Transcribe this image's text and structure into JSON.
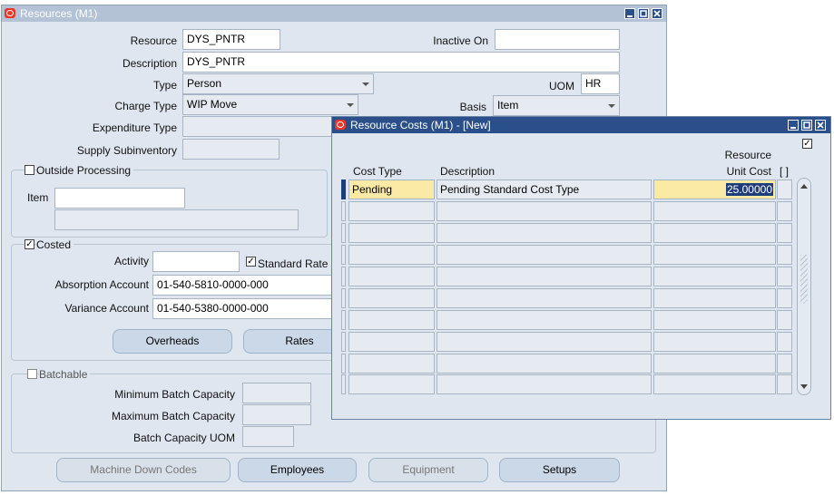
{
  "main_window": {
    "title": "Resources (M1)",
    "fields": {
      "resource": {
        "label": "Resource",
        "value": "DYS_PNTR"
      },
      "inactive_on": {
        "label": "Inactive On",
        "value": ""
      },
      "description": {
        "label": "Description",
        "value": "DYS_PNTR"
      },
      "type": {
        "label": "Type",
        "value": "Person"
      },
      "uom": {
        "label": "UOM",
        "value": "HR"
      },
      "charge_type": {
        "label": "Charge Type",
        "value": "WIP Move"
      },
      "basis": {
        "label": "Basis",
        "value": "Item"
      },
      "expenditure_type": {
        "label": "Expenditure Type",
        "value": ""
      },
      "supply_subinventory": {
        "label": "Supply Subinventory",
        "value": ""
      }
    },
    "outside_processing": {
      "label": "Outside Processing",
      "checked": false,
      "item_label": "Item",
      "item_value": "",
      "item_desc": ""
    },
    "costed": {
      "label": "Costed",
      "checked": true,
      "activity_label": "Activity",
      "activity_value": "",
      "standard_rate_label": "Standard Rate",
      "standard_rate_checked": true,
      "absorption_label": "Absorption Account",
      "absorption_value": "01-540-5810-0000-000",
      "variance_label": "Variance Account",
      "variance_value": "01-540-5380-0000-000",
      "overheads_button": "Overheads",
      "rates_button": "Rates"
    },
    "batchable": {
      "label": "Batchable",
      "checked": false,
      "min_label": "Minimum Batch Capacity",
      "max_label": "Maximum Batch Capacity",
      "uom_label": "Batch Capacity UOM"
    },
    "buttons": {
      "machine_down_codes": "Machine Down Codes",
      "employees": "Employees",
      "equipment": "Equipment",
      "setups": "Setups"
    }
  },
  "cost_window": {
    "title": "Resource Costs (M1) - [New]",
    "headers": {
      "cost_type": "Cost Type",
      "description": "Description",
      "resource": "Resource",
      "unit_cost": "Unit Cost",
      "folder": "[ ]"
    },
    "rows": [
      {
        "cost_type": "Pending",
        "description": "Pending Standard Cost Type",
        "unit_cost": "25.00000"
      },
      {
        "cost_type": "",
        "description": "",
        "unit_cost": ""
      },
      {
        "cost_type": "",
        "description": "",
        "unit_cost": ""
      },
      {
        "cost_type": "",
        "description": "",
        "unit_cost": ""
      },
      {
        "cost_type": "",
        "description": "",
        "unit_cost": ""
      },
      {
        "cost_type": "",
        "description": "",
        "unit_cost": ""
      },
      {
        "cost_type": "",
        "description": "",
        "unit_cost": ""
      },
      {
        "cost_type": "",
        "description": "",
        "unit_cost": ""
      },
      {
        "cost_type": "",
        "description": "",
        "unit_cost": ""
      },
      {
        "cost_type": "",
        "description": "",
        "unit_cost": ""
      }
    ]
  },
  "colors": {
    "title_main": "#b4c2d6",
    "title_active": "#2a4f8a",
    "field_highlight": "#fbe9a6"
  },
  "icons": [
    "oracle-logo-icon",
    "minimize-icon",
    "maximize-icon",
    "close-icon",
    "checkbox-icon",
    "chevron-down-icon",
    "scroll-up-icon",
    "scroll-down-icon"
  ]
}
